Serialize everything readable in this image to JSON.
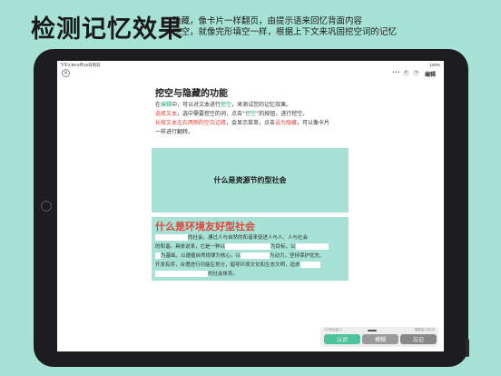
{
  "promo": {
    "title": "检测记忆效果",
    "desc_line1": "隐藏，像卡片一样翻页，由提示语来回忆背面内容",
    "desc_line2": "挖空，就像完形填空一样，根据上下文来巩固挖空词的记忆"
  },
  "statusbar": {
    "time": "下午2:59  5月16日周日",
    "right": "100%"
  },
  "toolbar": {
    "close": "✕",
    "more": "•••",
    "edit": "编辑"
  },
  "guide": {
    "title": "挖空与隐藏的功能",
    "line1_prefix": "在",
    "line1_edit": "编辑",
    "line1_mid": "中，可以对文本进行",
    "line1_blank": "挖空",
    "line1_suffix": "，来测试您的记忆效果。",
    "line2_select": "选择文本",
    "line2_mid": "，选中需要挖空的词，点击“",
    "line2_blank": "挖空",
    "line2_suffix": "”的按钮，进行挖空。",
    "line3_longpress": "长按文本左右两侧的空白边缘",
    "line3_mid": "，会显示菜单，点击",
    "line3_hide": "设为隐藏",
    "line3_suffix": "，可以像卡片",
    "line4": "一样进行翻转。"
  },
  "card": {
    "front": "什么是资源节约型社会",
    "back_title": "什么是环境友好型社会",
    "back_l1": "的社会，通过人与自然的和谐来促进人与人、人与社会",
    "back_l2a": "的和谐。具体说来，它是一种以",
    "back_l2b": "为目标，以",
    "back_l3a": "为基础，以遵循自然规律为核心，以",
    "back_l3b": "为动力，坚持保护优先、",
    "back_l4a": "开发有序，合理进行功能区划分，倡导环境文化和生态文明，追求",
    "back_l5": "的社会体系。"
  },
  "bottom_bar": {
    "caption_left": "1小时后复习",
    "caption_right": "重新复习/忘记",
    "know": "认识",
    "fuzzy": "模糊",
    "forget": "忘记"
  },
  "colors": {
    "accent": "#4cc39c",
    "card_bg": "#a6e3d6",
    "highlight_red": "#e0453a",
    "highlight_green": "#2aa37e"
  }
}
